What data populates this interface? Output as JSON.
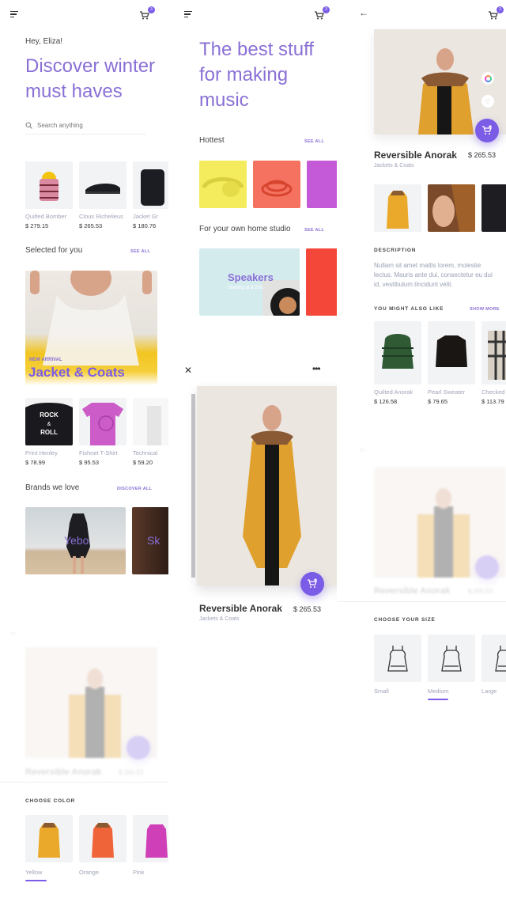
{
  "colors": {
    "accent": "#7b5ce6",
    "hero_text": "#8a70d6",
    "muted": "#a0a4b8"
  },
  "screen1": {
    "cart_badge": "3",
    "greeting": "Hey, Eliza!",
    "hero_line1": "Discover winter",
    "hero_line2": "must haves",
    "search_placeholder": "Search anything",
    "products": [
      {
        "name": "Quilted Bomber",
        "price": "$ 279.15"
      },
      {
        "name": "Clous Richelieus",
        "price": "$ 265.53"
      },
      {
        "name": "Jacket Gr",
        "price": "$ 180.76"
      }
    ],
    "selected_title": "Selected for you",
    "selected_link": "SEE ALL",
    "banner_tag": "NEW ARRIVAL",
    "banner_title": "Jacket & Coats",
    "selected_products": [
      {
        "name": "Print Henley",
        "price": "$ 78.99"
      },
      {
        "name": "Fishnet T-Shirt",
        "price": "$ 95.53"
      },
      {
        "name": "Technical",
        "price": "$ 59.20"
      }
    ],
    "brands_title": "Brands we love",
    "brands_link": "DISCOVER ALL",
    "brands": [
      "Yebo",
      "Sk"
    ],
    "faded_product_title": "Reversible Anorak",
    "faded_product_price": "$ 265.53",
    "color_caption": "CHOOSE COLOR",
    "colors": [
      {
        "label": "Yellow",
        "selected": true
      },
      {
        "label": "Orange",
        "selected": false
      },
      {
        "label": "Pink",
        "selected": false
      }
    ]
  },
  "screen2": {
    "cart_badge": "3",
    "hero_line1": "The best stuff",
    "hero_line2": "for making",
    "hero_line3": "music",
    "hottest_title": "Hottest",
    "hottest_link": "SEE ALL",
    "studio_title": "For your own home studio",
    "studio_link": "SEE ALL",
    "studio_card_title": "Speakers",
    "studio_card_sub": "Starting at $ 200",
    "product_title": "Reversible Anorak",
    "product_category": "Jackets & Coats",
    "product_price": "$ 265.53"
  },
  "screen3": {
    "cart_badge": "3",
    "product_title": "Reversible Anorak",
    "product_category": "Jackets & Coats",
    "product_price": "$ 265.53",
    "description_caption": "DESCRIPTION",
    "description": "Nullam sit amet mattis lorem, molestie lectus. Mauris ante dui, consectetur eu dui id, vestibulum tincidunt velit.",
    "also_like_caption": "YOU MIGHT ALSO LIKE",
    "also_like_link": "SHOW MORE",
    "also_like": [
      {
        "name": "Quilted Anorak",
        "price": "$ 126.58"
      },
      {
        "name": "Pearl Sweater",
        "price": "$ 79.65"
      },
      {
        "name": "Checked",
        "price": "$ 113.79"
      }
    ],
    "faded_product_title": "Reversible Anorak",
    "faded_product_price": "$ 265.53",
    "size_caption": "CHOOSE YOUR SIZE",
    "sizes": [
      {
        "label": "Small",
        "selected": false
      },
      {
        "label": "Medium",
        "selected": true
      },
      {
        "label": "Large",
        "selected": false
      }
    ]
  }
}
